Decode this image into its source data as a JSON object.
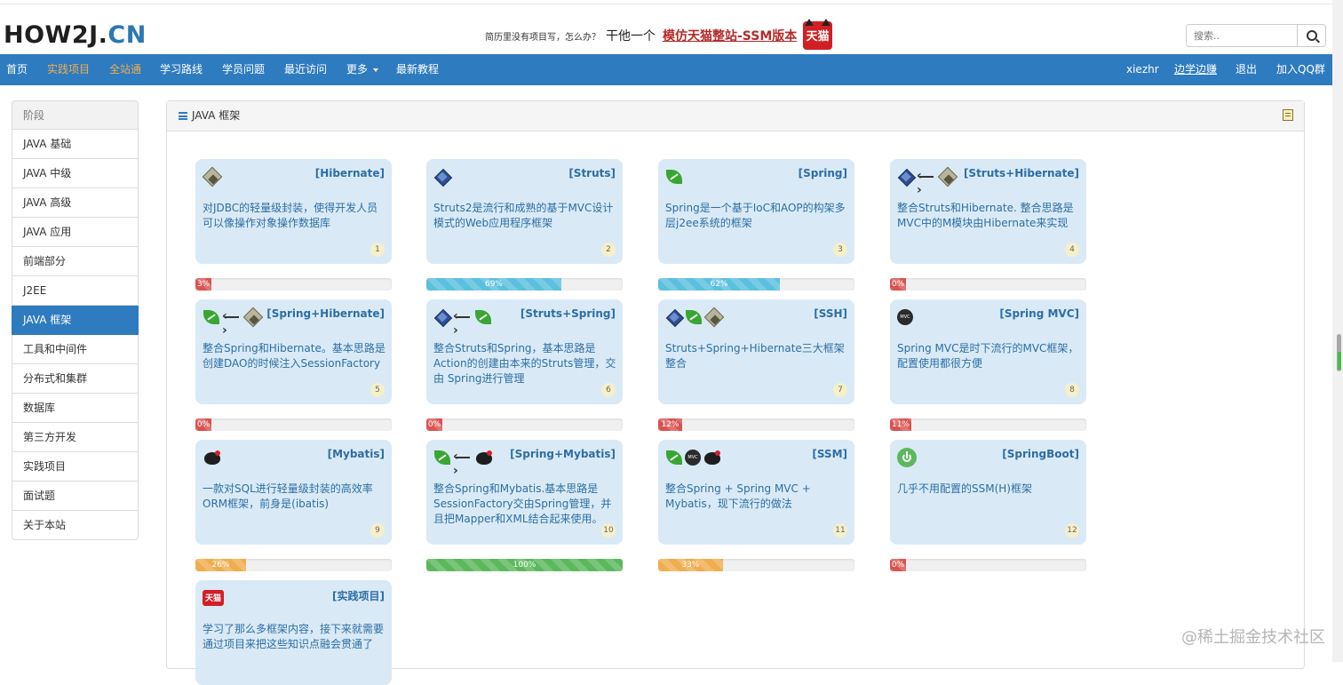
{
  "header": {
    "logo_a": "HOW2J.",
    "logo_b": "CN",
    "promo_small": "简历里没有项目写，怎么办？",
    "promo_mid": "干他一个",
    "promo_link": "模仿天猫整站-SSM版本",
    "tmall_badge": "天猫",
    "search_placeholder": "搜索..",
    "search_icon": "search-icon"
  },
  "nav": {
    "left": [
      {
        "label": "首页",
        "hl": false
      },
      {
        "label": "实践项目",
        "hl": true
      },
      {
        "label": "全站通",
        "hl": true
      },
      {
        "label": "学习路线",
        "hl": false
      },
      {
        "label": "学员问题",
        "hl": false
      },
      {
        "label": "最近访问",
        "hl": false
      },
      {
        "label": "更多",
        "hl": false
      },
      {
        "label": "最新教程",
        "hl": false
      }
    ],
    "right": [
      {
        "label": "xiezhr"
      },
      {
        "label": "边学边赚"
      },
      {
        "label": "退出"
      },
      {
        "label": "加入QQ群"
      }
    ]
  },
  "sidebar": {
    "heading": "阶段",
    "items": [
      "JAVA 基础",
      "JAVA 中级",
      "JAVA 高级",
      "JAVA 应用",
      "前端部分",
      "J2EE",
      "JAVA 框架",
      "工具和中间件",
      "分布式和集群",
      "数据库",
      "第三方开发",
      "实践项目",
      "面试题",
      "关于本站"
    ],
    "active_index": 6
  },
  "panel": {
    "title": "JAVA 框架",
    "list_icon": "list-icon",
    "note_icon": "note-icon"
  },
  "cards": [
    {
      "title": "[Hibernate]",
      "desc": "对JDBC的轻量级封装，使得开发人员可以像操作对象操作数据库",
      "num": "1",
      "icons": [
        "hibernate"
      ],
      "progress": "3%",
      "pct": 3,
      "color": "#d9534f"
    },
    {
      "title": "[Struts]",
      "desc": "Struts2是流行和成熟的基于MVC设计模式的Web应用程序框架",
      "num": "2",
      "icons": [
        "struts"
      ],
      "progress": "69%",
      "pct": 69,
      "color": "#5bc0de"
    },
    {
      "title": "[Spring]",
      "desc": "Spring是一个基于IoC和AOP的构架多层j2ee系统的框架",
      "num": "3",
      "icons": [
        "spring"
      ],
      "progress": "62%",
      "pct": 62,
      "color": "#5bc0de"
    },
    {
      "title": "[Struts+Hibernate]",
      "desc": "整合Struts和Hibernate. 整合思路是MVC中的M模块由Hibernate来实现",
      "num": "4",
      "icons": [
        "struts",
        "arrow",
        "hibernate"
      ],
      "progress": "0%",
      "pct": 0,
      "color": "#d9534f"
    },
    {
      "title": "[Spring+Hibernate]",
      "desc": "整合Spring和Hibernate。基本思路是创建DAO的时候注入SessionFactory",
      "num": "5",
      "icons": [
        "spring",
        "arrow",
        "hibernate"
      ],
      "progress": "0%",
      "pct": 0,
      "color": "#d9534f"
    },
    {
      "title": "[Struts+Spring]",
      "desc": "整合Struts和Spring，基本思路是Action的创建由本来的Struts管理，交由 Spring进行管理",
      "num": "6",
      "icons": [
        "struts",
        "arrow",
        "spring"
      ],
      "progress": "0%",
      "pct": 0,
      "color": "#d9534f"
    },
    {
      "title": "[SSH]",
      "desc": "Struts+Spring+Hibernate三大框架整合",
      "num": "7",
      "icons": [
        "struts",
        "spring",
        "hibernate"
      ],
      "progress": "12%",
      "pct": 12,
      "color": "#d9534f"
    },
    {
      "title": "[Spring MVC]",
      "desc": "Spring MVC是时下流行的MVC框架，配置使用都很方便",
      "num": "8",
      "icons": [
        "mvc"
      ],
      "progress": "11%",
      "pct": 11,
      "color": "#d9534f"
    },
    {
      "title": "[Mybatis]",
      "desc": "一款对SQL进行轻量级封装的高效率ORM框架，前身是(ibatis)",
      "num": "9",
      "icons": [
        "mybatis"
      ],
      "progress": "26%",
      "pct": 26,
      "color": "#f0ad4e"
    },
    {
      "title": "[Spring+Mybatis]",
      "desc": "整合Spring和Mybatis.基本思路是SessionFactory交由Spring管理，并且把Mapper和XML结合起来使用。",
      "num": "10",
      "icons": [
        "spring",
        "arrow",
        "mybatis"
      ],
      "progress": "100%",
      "pct": 100,
      "color": "#5cb85c"
    },
    {
      "title": "[SSM]",
      "desc": "整合Spring + Spring MVC + Mybatis，现下流行的做法",
      "num": "11",
      "icons": [
        "spring",
        "mvc",
        "mybatis"
      ],
      "progress": "33%",
      "pct": 33,
      "color": "#f0ad4e"
    },
    {
      "title": "[SpringBoot]",
      "desc": "几乎不用配置的SSM(H)框架",
      "num": "12",
      "icons": [
        "boot"
      ],
      "progress": "0%",
      "pct": 0,
      "color": "#d9534f"
    },
    {
      "title": "[实践项目]",
      "desc": "学习了那么多框架内容，接下来就需要通过项目来把这些知识点融会贯通了",
      "num": "",
      "icons": [
        "tmall"
      ],
      "progress": null,
      "pct": null,
      "color": null
    }
  ],
  "mvc_icon_text": "MVC",
  "tmall_icon_text": "天猫",
  "watermark": "@稀土掘金技术社区"
}
